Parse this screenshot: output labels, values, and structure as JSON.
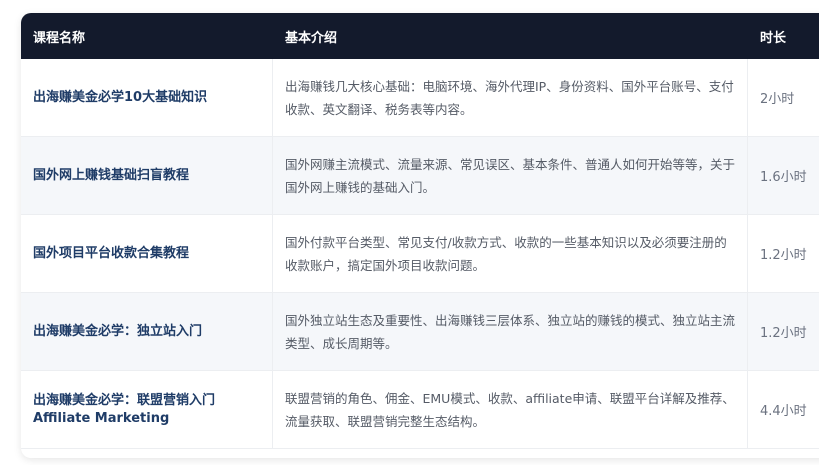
{
  "table": {
    "headers": {
      "name": "课程名称",
      "desc": "基本介绍",
      "duration": "时长"
    },
    "rows": [
      {
        "name": "出海赚美金必学10大基础知识",
        "desc": "出海赚钱几大核心基础：电脑环境、海外代理IP、身份资料、国外平台账号、支付收款、英文翻译、税务表等内容。",
        "duration": "2小时"
      },
      {
        "name": "国外网上赚钱基础扫盲教程",
        "desc": "国外网赚主流模式、流量来源、常见误区、基本条件、普通人如何开始等等，关于国外网上赚钱的基础入门。",
        "duration": "1.6小时"
      },
      {
        "name": "国外项目平台收款合集教程",
        "desc": "国外付款平台类型、常见支付/收款方式、收款的一些基本知识以及必须要注册的收款账户，搞定国外项目收款问题。",
        "duration": "1.2小时"
      },
      {
        "name": "出海赚美金必学：独立站入门",
        "desc": "国外独立站生态及重要性、出海赚钱三层体系、独立站的赚钱的模式、独立站主流类型、成长周期等。",
        "duration": "1.2小时"
      },
      {
        "name": "出海赚美金必学：联盟营销入门 Affiliate Marketing",
        "desc": "联盟营销的角色、佣金、EMU模式、收款、affiliate申请、联盟平台详解及推荐、流量获取、联盟营销完整生态结构。",
        "duration": "4.4小时"
      }
    ]
  }
}
